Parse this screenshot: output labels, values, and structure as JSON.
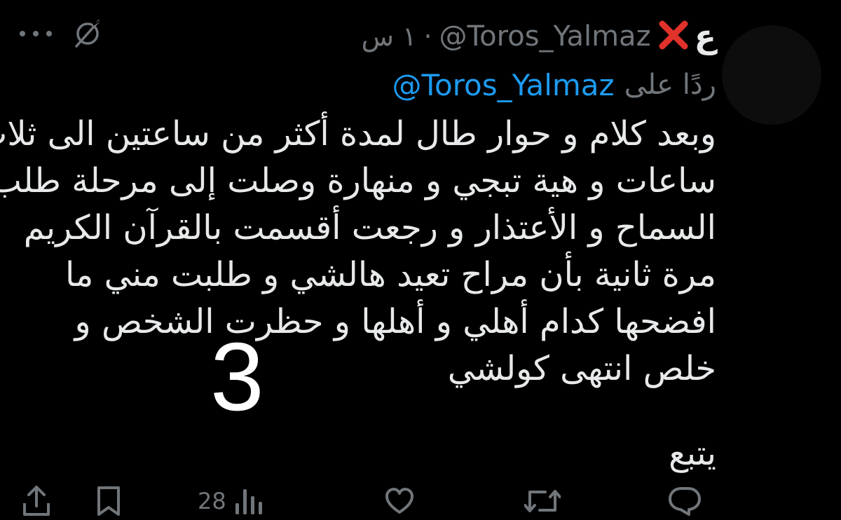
{
  "tweet": {
    "display_name": "ع",
    "handle": "@Toros_Yalmaz",
    "separator": "·",
    "time": "١ س",
    "reply_prefix": "ردًا على",
    "reply_handle": "@Toros_Yalmaz",
    "body_lines": [
      "وبعد كلام و حوار طال لمدة أكثر من ساعتين الى ثلاث",
      "ساعات و هية تبجي و منهارة وصلت إلى مرحلة طلب",
      "السماح و الأعتذار و رجعت أقسمت بالقرآن الكريم",
      "مرة ثانية بأن مراح تعيد هالشي و طلبت مني ما",
      "افضحها كدام أهلي و أهلها و حظرت الشخص و",
      "خلص انتهى كولشي"
    ],
    "continue_text": "يتبع",
    "overlay_number": "3"
  },
  "actions": {
    "views_count": "28"
  },
  "icons": {
    "reply": "reply-icon",
    "retweet": "retweet-icon",
    "like": "heart-icon",
    "views": "views-icon",
    "bookmark": "bookmark-icon",
    "share": "share-icon",
    "grok": "grok-icon",
    "more": "more-icon",
    "cross_emoji": "cross-mark-emoji"
  },
  "colors": {
    "background": "#000000",
    "text": "#e7e9ea",
    "muted": "#71767b",
    "link": "#1d9bf0",
    "cross": "#e0312b"
  }
}
